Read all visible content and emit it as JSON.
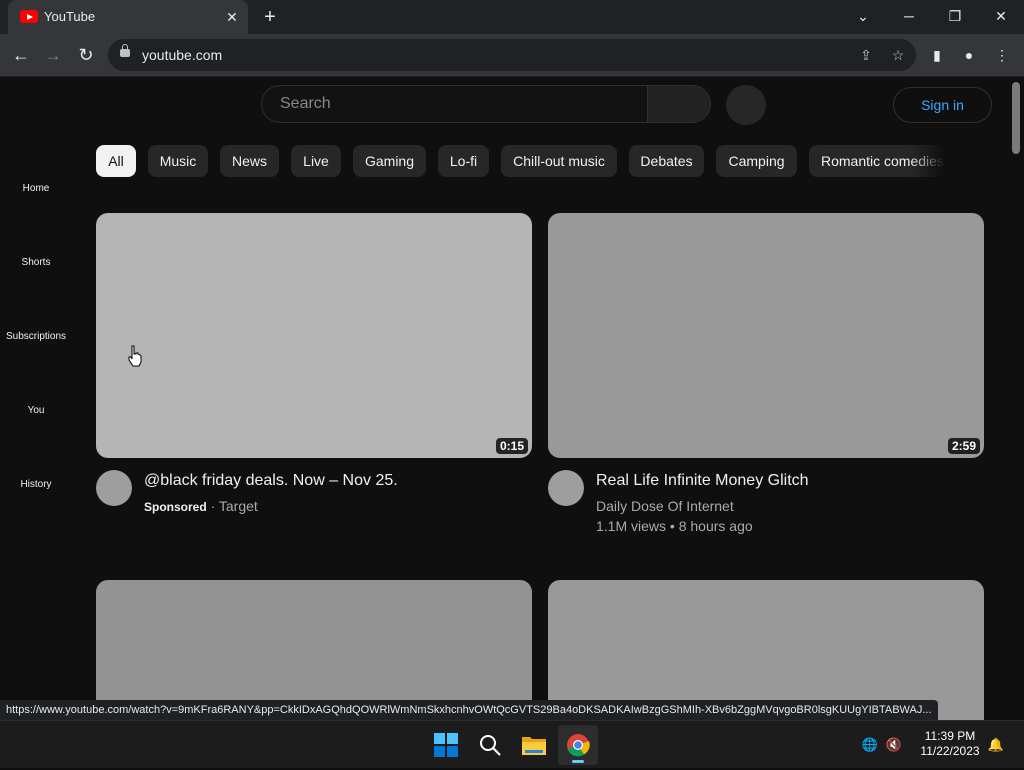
{
  "browser": {
    "tab_title": "YouTube",
    "url": "youtube.com",
    "status_url": "https://www.youtube.com/watch?v=9mKFra6RANY&pp=CkkIDxAGQhdQOWRlWmNmSkxhcnhvOWtQcGVTS29Ba4oDKSADKAIwBzgGShMIh-XBv6bZggMVqvgoBR0lsgKUUgYIBTABWAJ..."
  },
  "youtube": {
    "search": {
      "placeholder": "Search"
    },
    "sign_in_label": "Sign in",
    "left_nav": [
      "Home",
      "Shorts",
      "Subscriptions",
      "You",
      "History"
    ],
    "chips": [
      "All",
      "Music",
      "News",
      "Live",
      "Gaming",
      "Lo-fi",
      "Chill-out music",
      "Debates",
      "Camping",
      "Romantic comedies"
    ],
    "videos": [
      {
        "title": "@black friday deals. Now – Nov 25.",
        "sponsored_label": "Sponsored",
        "channel": "Target",
        "duration": "0:15"
      },
      {
        "title": "Real Life Infinite Money Glitch",
        "channel": "Daily Dose Of Internet",
        "stats": "1.1M views • 8 hours ago",
        "duration": "2:59"
      }
    ]
  },
  "taskbar": {
    "time": "11:39 PM",
    "date": "11/22/2023",
    "apps": [
      "windows-start-icon",
      "search-icon",
      "file-explorer-icon",
      "chrome-icon"
    ]
  },
  "colors": {
    "accent_blue": "#3ea6ff",
    "background": "#0f0f0f",
    "chip_active": "#f1f1f1"
  }
}
